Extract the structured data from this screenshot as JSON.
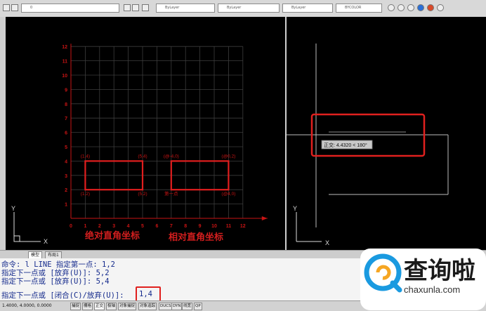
{
  "toolbar": {
    "layer_value": "0",
    "color_value": "ByLayer",
    "linetype_value": "ByLayer",
    "lineweight_value": "ByLayer",
    "plotstyle_value": "BYCOLOR"
  },
  "grid_plot": {
    "x_ticks": [
      "0",
      "1",
      "2",
      "3",
      "4",
      "5",
      "6",
      "7",
      "8",
      "9",
      "10",
      "11",
      "12"
    ],
    "y_ticks": [
      "1",
      "2",
      "3",
      "4",
      "5",
      "6",
      "7",
      "8",
      "9",
      "10",
      "11",
      "12"
    ],
    "x_axis_letter": "X",
    "y_axis_letter": "Y",
    "points": [
      {
        "label": "(1,4)",
        "x": 1,
        "y": 4
      },
      {
        "label": "(5,4)",
        "x": 5,
        "y": 4
      },
      {
        "label": "(1,2)",
        "x": 1,
        "y": 2
      },
      {
        "label": "(5,2)",
        "x": 5,
        "y": 2
      },
      {
        "label": "(@-4,0)",
        "x": 7,
        "y": 4
      },
      {
        "label": "(@0,2)",
        "x": 11,
        "y": 4
      },
      {
        "label": "第一点",
        "x": 7,
        "y": 2
      },
      {
        "label": "(@4,0)",
        "x": 11,
        "y": 2
      }
    ],
    "absolute_caption": "绝对直角坐标",
    "relative_caption": "相对直角坐标",
    "colors": {
      "grid": "#3d3d3d",
      "axis_red": "#c81414",
      "rect_red": "#e01e1e",
      "caption_red": "#d21e1e"
    }
  },
  "right_viewport": {
    "tooltip": "正交: 4.4320 < 180°",
    "x_axis_letter": "X",
    "y_axis_letter": "Y",
    "highlight_color": "#e0201e"
  },
  "layout_tabs": [
    "模型",
    "布局1"
  ],
  "command_lines": [
    "命令: l LINE 指定第一点: 1,2",
    "指定下一点或 [放弃(U)]: 5,2",
    "指定下一点或 [放弃(U)]: 5,4"
  ],
  "command_prompt": "指定下一点或 [闭合(C)/放弃(U)]:",
  "command_input": "1,4",
  "status": {
    "coordinates": "1.4000, 4.0000, 0.0000",
    "buttons": [
      "捕捉",
      "栅格",
      "正交",
      "极轴",
      "对象捕捉",
      "对象追踪",
      "DUCS",
      "DYN",
      "线宽",
      "QP"
    ]
  },
  "watermark": {
    "title": "查询啦",
    "url": "chaxunla.com"
  }
}
